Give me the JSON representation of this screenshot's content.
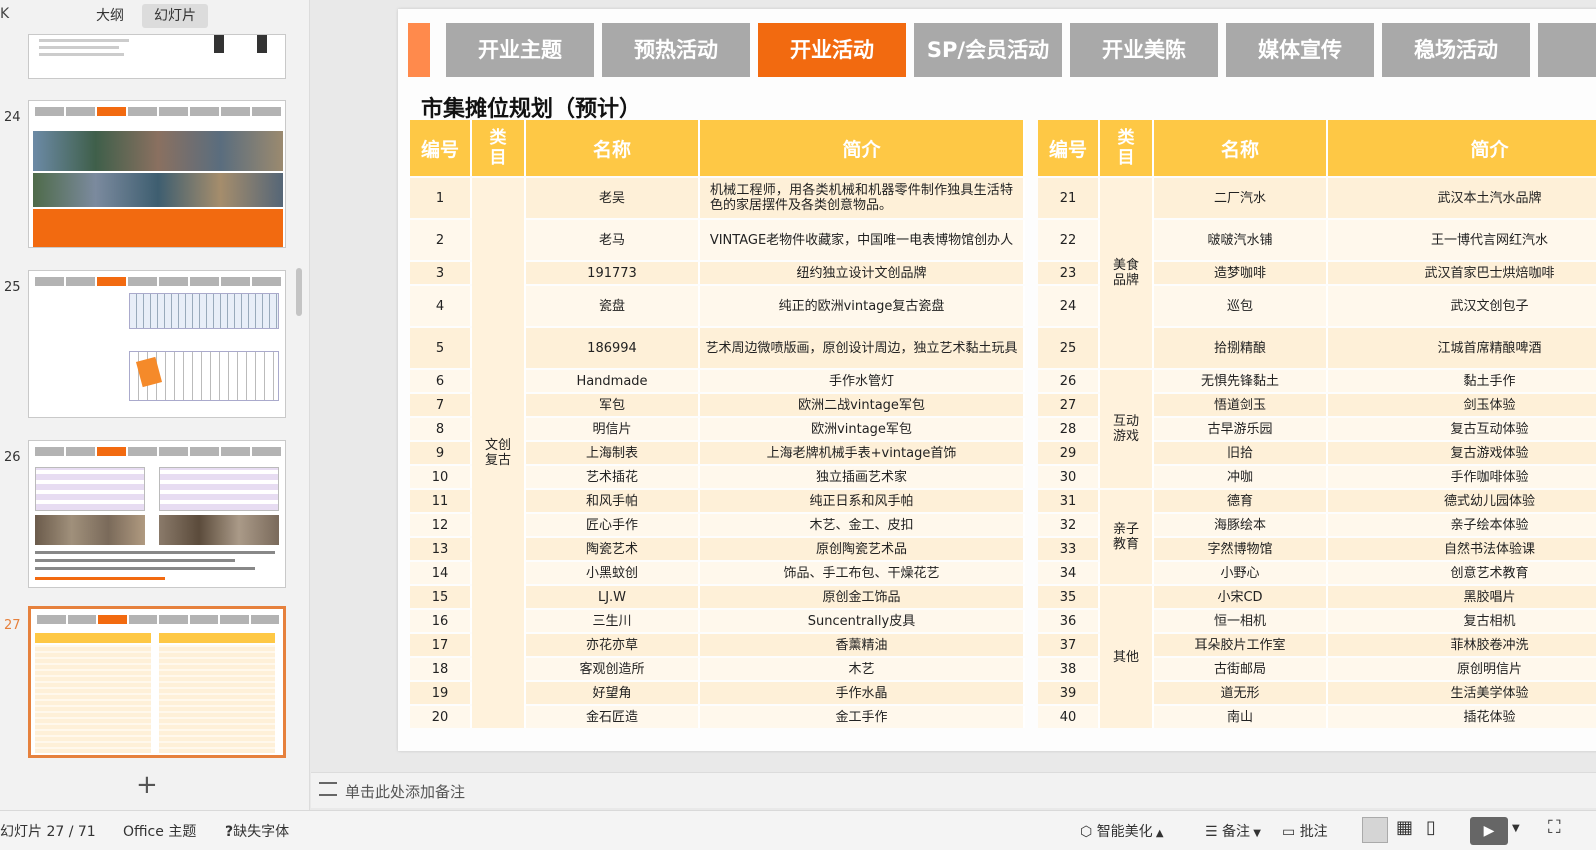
{
  "sidebar": {
    "tabs": {
      "outline": "大纲",
      "slides": "幻灯片"
    },
    "collapse_glyph": "K",
    "slide_numbers": [
      "24",
      "25",
      "26",
      "27"
    ]
  },
  "slide": {
    "nav": [
      "开业主题",
      "预热活动",
      "开业活动",
      "SP/会员活动",
      "开业美陈",
      "媒体宣传",
      "稳场活动"
    ],
    "active_nav": "开业活动",
    "title": "市集摊位规划（预计）",
    "headers": [
      "编号",
      "类目",
      "名称",
      "简介"
    ],
    "left_table": {
      "category": "文创复古",
      "rows": [
        {
          "no": "1",
          "name": "老吴",
          "desc": "机械工程师，用各类机械和机器零件制作独具生活特色的家居摆件及各类创意物品。"
        },
        {
          "no": "2",
          "name": "老马",
          "desc": "VINTAGE老物件收藏家，中国唯一电表博物馆创办人"
        },
        {
          "no": "3",
          "name": "191773",
          "desc": "纽约独立设计文创品牌"
        },
        {
          "no": "4",
          "name": "瓷盘",
          "desc": "纯正的欧洲vintage复古瓷盘"
        },
        {
          "no": "5",
          "name": "186994",
          "desc": "艺术周边微喷版画，原创设计周边，独立艺术黏土玩具"
        },
        {
          "no": "6",
          "name": "Handmade",
          "desc": "手作水管灯"
        },
        {
          "no": "7",
          "name": "军包",
          "desc": "欧洲二战vintage军包"
        },
        {
          "no": "8",
          "name": "明信片",
          "desc": "欧洲vintage军包"
        },
        {
          "no": "9",
          "name": "上海制表",
          "desc": "上海老牌机械手表+vintage首饰"
        },
        {
          "no": "10",
          "name": "艺术插花",
          "desc": "独立插画艺术家"
        },
        {
          "no": "11",
          "name": "和风手帕",
          "desc": "纯正日系和风手帕"
        },
        {
          "no": "12",
          "name": "匠心手作",
          "desc": "木艺、金工、皮扣"
        },
        {
          "no": "13",
          "name": "陶瓷艺术",
          "desc": "原创陶瓷艺术品"
        },
        {
          "no": "14",
          "name": "小黑蚊创",
          "desc": "饰品、手工布包、干燥花艺"
        },
        {
          "no": "15",
          "name": "LJ.W",
          "desc": "原创金工饰品"
        },
        {
          "no": "16",
          "name": "三生川",
          "desc": "Suncentrally皮具"
        },
        {
          "no": "17",
          "name": "亦花亦草",
          "desc": "香薰精油"
        },
        {
          "no": "18",
          "name": "客观创造所",
          "desc": "木艺"
        },
        {
          "no": "19",
          "name": "好望角",
          "desc": "手作水晶"
        },
        {
          "no": "20",
          "name": "金石匠造",
          "desc": "金工手作"
        }
      ]
    },
    "right_table": {
      "categories": [
        {
          "label": "美食品牌",
          "span": 5
        },
        {
          "label": "互动游戏",
          "span": 5
        },
        {
          "label": "亲子教育",
          "span": 4
        },
        {
          "label": "其他",
          "span": 6
        }
      ],
      "rows": [
        {
          "no": "21",
          "name": "二厂汽水",
          "desc": "武汉本土汽水品牌"
        },
        {
          "no": "22",
          "name": "啵啵汽水铺",
          "desc": "王一博代言网红汽水"
        },
        {
          "no": "23",
          "name": "造梦咖啡",
          "desc": "武汉首家巴士烘焙咖啡"
        },
        {
          "no": "24",
          "name": "巡包",
          "desc": "武汉文创包子"
        },
        {
          "no": "25",
          "name": "拾捌精酿",
          "desc": "江城首席精酿啤酒"
        },
        {
          "no": "26",
          "name": "无惧先锋黏土",
          "desc": "黏土手作"
        },
        {
          "no": "27",
          "name": "悟道剑玉",
          "desc": "剑玉体验"
        },
        {
          "no": "28",
          "name": "古早游乐园",
          "desc": "复古互动体验"
        },
        {
          "no": "29",
          "name": "旧拾",
          "desc": "复古游戏体验"
        },
        {
          "no": "30",
          "name": "冲咖",
          "desc": "手作咖啡体验"
        },
        {
          "no": "31",
          "name": "德育",
          "desc": "德式幼儿园体验"
        },
        {
          "no": "32",
          "name": "海豚绘本",
          "desc": "亲子绘本体验"
        },
        {
          "no": "33",
          "name": "字然博物馆",
          "desc": "自然书法体验课"
        },
        {
          "no": "34",
          "name": "小野心",
          "desc": "创意艺术教育"
        },
        {
          "no": "35",
          "name": "小宋CD",
          "desc": "黑胶唱片"
        },
        {
          "no": "36",
          "name": "恒一相机",
          "desc": "复古相机"
        },
        {
          "no": "37",
          "name": "耳朵胶片工作室",
          "desc": "菲林胶卷冲洗"
        },
        {
          "no": "38",
          "name": "古街邮局",
          "desc": "原创明信片"
        },
        {
          "no": "39",
          "name": "道无形",
          "desc": "生活美学体验"
        },
        {
          "no": "40",
          "name": "南山",
          "desc": "插花体验"
        }
      ]
    }
  },
  "notes": {
    "placeholder": "单击此处添加备注"
  },
  "status": {
    "slide_counter": "幻灯片 27 / 71",
    "theme": "Office 主题",
    "missing_font": "缺失字体",
    "beautify": "智能美化",
    "notes_btn": "备注",
    "comment_btn": "批注"
  },
  "colors": {
    "accent": "#f26a10",
    "header": "#fec845",
    "nav_inactive": "#a9a9a9",
    "selection": "#e6813d"
  }
}
